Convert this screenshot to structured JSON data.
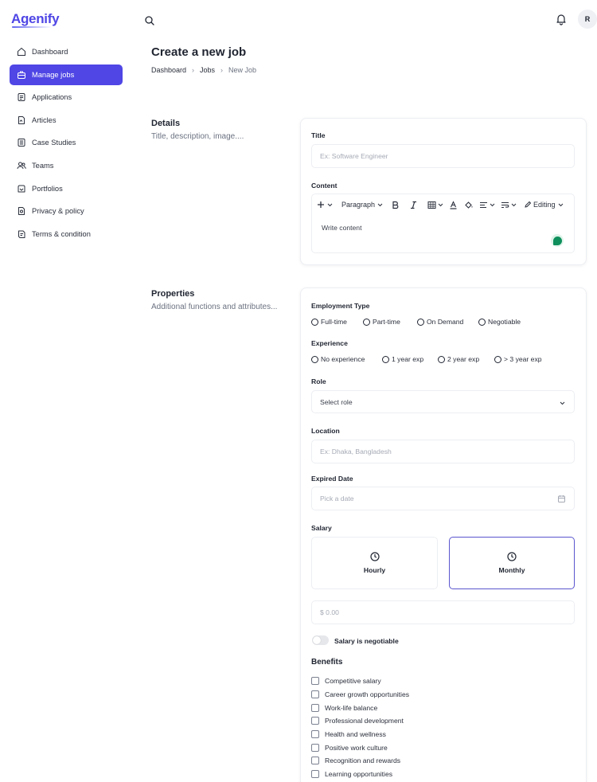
{
  "brand": {
    "name": "Agenify"
  },
  "topbar": {
    "search_icon": "search-icon",
    "bell_icon": "bell-icon",
    "avatar_initial": "R"
  },
  "sidebar": {
    "items": [
      {
        "label": "Dashboard",
        "icon": "home-icon",
        "active": false
      },
      {
        "label": "Manage jobs",
        "icon": "briefcase-icon",
        "active": true
      },
      {
        "label": "Applications",
        "icon": "clipboard-icon",
        "active": false
      },
      {
        "label": "Articles",
        "icon": "article-icon",
        "active": false
      },
      {
        "label": "Case Studies",
        "icon": "document-icon",
        "active": false
      },
      {
        "label": "Teams",
        "icon": "users-icon",
        "active": false
      },
      {
        "label": "Portfolios",
        "icon": "portfolio-icon",
        "active": false
      },
      {
        "label": "Privacy & policy",
        "icon": "shield-icon",
        "active": false
      },
      {
        "label": "Terms & condition",
        "icon": "terms-icon",
        "active": false
      }
    ]
  },
  "header": {
    "title": "Create a new job",
    "breadcrumb": [
      "Dashboard",
      "Jobs",
      "New Job"
    ]
  },
  "details": {
    "heading": "Details",
    "subheading": "Title, description, image....",
    "title_label": "Title",
    "title_placeholder": "Ex: Software Engineer",
    "content_label": "Content",
    "editor": {
      "paragraph_label": "Paragraph",
      "editing_label": "Editing",
      "placeholder": "Write content"
    }
  },
  "properties": {
    "heading": "Properties",
    "subheading": "Additional functions and attributes...",
    "employment_type": {
      "label": "Employment Type",
      "options": [
        "Full-time",
        "Part-time",
        "On Demand",
        "Negotiable"
      ]
    },
    "experience": {
      "label": "Experience",
      "options": [
        "No experience",
        "1 year exp",
        "2 year exp",
        "> 3 year exp"
      ]
    },
    "role": {
      "label": "Role",
      "value": "Select role"
    },
    "location": {
      "label": "Location",
      "placeholder": "Ex: Dhaka, Bangladesh"
    },
    "expired_date": {
      "label": "Expired Date",
      "placeholder": "Pick a date"
    },
    "salary": {
      "label": "Salary",
      "options": [
        "Hourly",
        "Monthly"
      ],
      "selected": "Monthly",
      "amount_placeholder": "$ 0.00",
      "negotiable_label": "Salary is negotiable",
      "negotiable": false
    },
    "benefits": {
      "label": "Benefits",
      "items": [
        "Competitive salary",
        "Career growth opportunities",
        "Work-life balance",
        "Professional development",
        "Health and wellness",
        "Positive work culture",
        "Recognition and rewards",
        "Learning opportunities"
      ]
    }
  },
  "colors": {
    "accent": "#4f46e5",
    "selected_border": "#5a55cf",
    "editor_badge": "#0e8f5b"
  }
}
